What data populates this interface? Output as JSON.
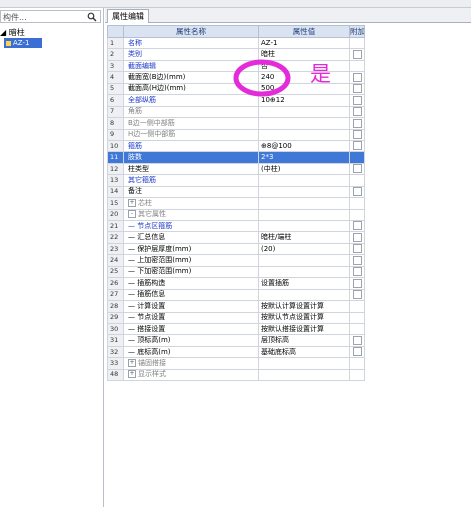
{
  "toolbar": {
    "items": [
      "",
      "",
      "",
      "",
      "",
      ""
    ]
  },
  "left_panel": {
    "search_placeholder": "构件...",
    "tree_root_label": "暗柱",
    "tree_item_label": "AZ-1"
  },
  "tab": {
    "label": "属性编辑"
  },
  "table": {
    "headers": {
      "name": "属性名称",
      "value": "属性值",
      "add": "附加"
    },
    "rows": [
      {
        "num": "1",
        "name": "名称",
        "value": "AZ-1",
        "add": false,
        "cls": "blue",
        "expand": ""
      },
      {
        "num": "2",
        "name": "类别",
        "value": "暗柱",
        "add": true,
        "cls": "blue",
        "expand": ""
      },
      {
        "num": "3",
        "name": "截面编辑",
        "value": "否",
        "add": false,
        "cls": "blue",
        "expand": ""
      },
      {
        "num": "4",
        "name": "截面宽(B边)(mm)",
        "value": "240",
        "add": true,
        "cls": "",
        "expand": ""
      },
      {
        "num": "5",
        "name": "截面高(H边)(mm)",
        "value": "500",
        "add": true,
        "cls": "",
        "expand": ""
      },
      {
        "num": "6",
        "name": "全部纵筋",
        "value": "10⊕12",
        "add": true,
        "cls": "blue",
        "expand": ""
      },
      {
        "num": "7",
        "name": "角筋",
        "value": "",
        "add": true,
        "cls": "gray",
        "expand": ""
      },
      {
        "num": "8",
        "name": "B边一侧中部筋",
        "value": "",
        "add": true,
        "cls": "gray",
        "expand": ""
      },
      {
        "num": "9",
        "name": "H边一侧中部筋",
        "value": "",
        "add": true,
        "cls": "gray",
        "expand": ""
      },
      {
        "num": "10",
        "name": "箍筋",
        "value": "⊕8@100",
        "add": true,
        "cls": "blue",
        "expand": ""
      },
      {
        "num": "11",
        "name": "肢数",
        "value": "2*3",
        "add": false,
        "cls": "blue",
        "expand": "",
        "selected": true
      },
      {
        "num": "12",
        "name": "柱类型",
        "value": "(中柱)",
        "add": true,
        "cls": "",
        "expand": ""
      },
      {
        "num": "13",
        "name": "其它箍筋",
        "value": "",
        "add": false,
        "cls": "blue",
        "expand": ""
      },
      {
        "num": "14",
        "name": "备注",
        "value": "",
        "add": true,
        "cls": "",
        "expand": ""
      },
      {
        "num": "15",
        "name": "芯柱",
        "value": "",
        "add": false,
        "cls": "gray",
        "expand": "+"
      },
      {
        "num": "20",
        "name": "其它属性",
        "value": "",
        "add": false,
        "cls": "gray",
        "expand": "-"
      },
      {
        "num": "21",
        "name": "— 节点区箍筋",
        "value": "",
        "add": true,
        "cls": "blue",
        "expand": ""
      },
      {
        "num": "22",
        "name": "— 汇总信息",
        "value": "暗柱/端柱",
        "add": true,
        "cls": "",
        "expand": ""
      },
      {
        "num": "23",
        "name": "— 保护层厚度(mm)",
        "value": "(20)",
        "add": true,
        "cls": "",
        "expand": ""
      },
      {
        "num": "24",
        "name": "— 上加密范围(mm)",
        "value": "",
        "add": true,
        "cls": "",
        "expand": ""
      },
      {
        "num": "25",
        "name": "— 下加密范围(mm)",
        "value": "",
        "add": true,
        "cls": "",
        "expand": ""
      },
      {
        "num": "26",
        "name": "— 插筋构造",
        "value": "设置插筋",
        "add": true,
        "cls": "",
        "expand": ""
      },
      {
        "num": "27",
        "name": "— 插筋信息",
        "value": "",
        "add": true,
        "cls": "",
        "expand": ""
      },
      {
        "num": "28",
        "name": "— 计算设置",
        "value": "按默认计算设置计算",
        "add": false,
        "cls": "",
        "expand": ""
      },
      {
        "num": "29",
        "name": "— 节点设置",
        "value": "按默认节点设置计算",
        "add": false,
        "cls": "",
        "expand": ""
      },
      {
        "num": "30",
        "name": "— 搭接设置",
        "value": "按默认搭接设置计算",
        "add": false,
        "cls": "",
        "expand": ""
      },
      {
        "num": "31",
        "name": "— 顶标高(m)",
        "value": "层顶标高",
        "add": true,
        "cls": "",
        "expand": ""
      },
      {
        "num": "32",
        "name": "— 底标高(m)",
        "value": "基础底标高",
        "add": true,
        "cls": "",
        "expand": ""
      },
      {
        "num": "33",
        "name": "锚固搭接",
        "value": "",
        "add": false,
        "cls": "gray",
        "expand": "+"
      },
      {
        "num": "48",
        "name": "显示样式",
        "value": "",
        "add": false,
        "cls": "gray",
        "expand": "+"
      }
    ]
  },
  "annotation": {
    "text": "是",
    "color": "#e42bd9"
  },
  "colors": {
    "selected_row": "#3f78d6",
    "blue_label": "#1a36c9",
    "header_bg": "#d9e3f1"
  }
}
